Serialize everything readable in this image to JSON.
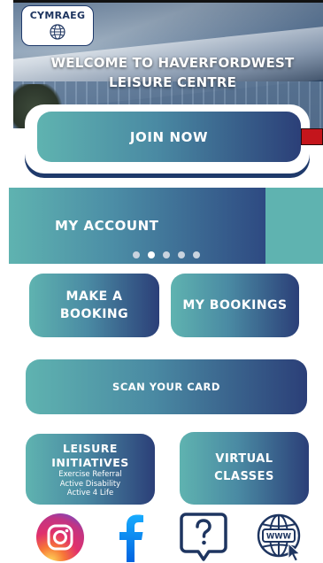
{
  "language_button": {
    "label": "CYMRAEG",
    "icon": "globe-icon"
  },
  "hero": {
    "title": "WELCOME TO HAVERFORDWEST LEISURE CENTRE"
  },
  "join": {
    "label": "JOIN NOW"
  },
  "carousel": {
    "current_label": "MY ACCOUNT",
    "page_count": 5,
    "active_index": 1
  },
  "tiles": {
    "make_booking": "MAKE A BOOKING",
    "my_bookings": "MY BOOKINGS",
    "scan_card": "SCAN YOUR CARD",
    "leisure_initiatives": {
      "title": "LEISURE INITIATIVES",
      "items": [
        "Exercise Referral",
        "Active Disability",
        "Active 4 Life"
      ]
    },
    "virtual_classes": "VIRTUAL CLASSES"
  },
  "social": {
    "instagram_icon": "instagram-icon",
    "facebook_icon": "facebook-icon",
    "help_icon": "help-question-icon",
    "website_icon": "website-globe-icon",
    "website_label": "WWW"
  },
  "colors": {
    "teal": "#5fb3b0",
    "navy": "#2b3f78",
    "accent_red": "#c4151c"
  }
}
